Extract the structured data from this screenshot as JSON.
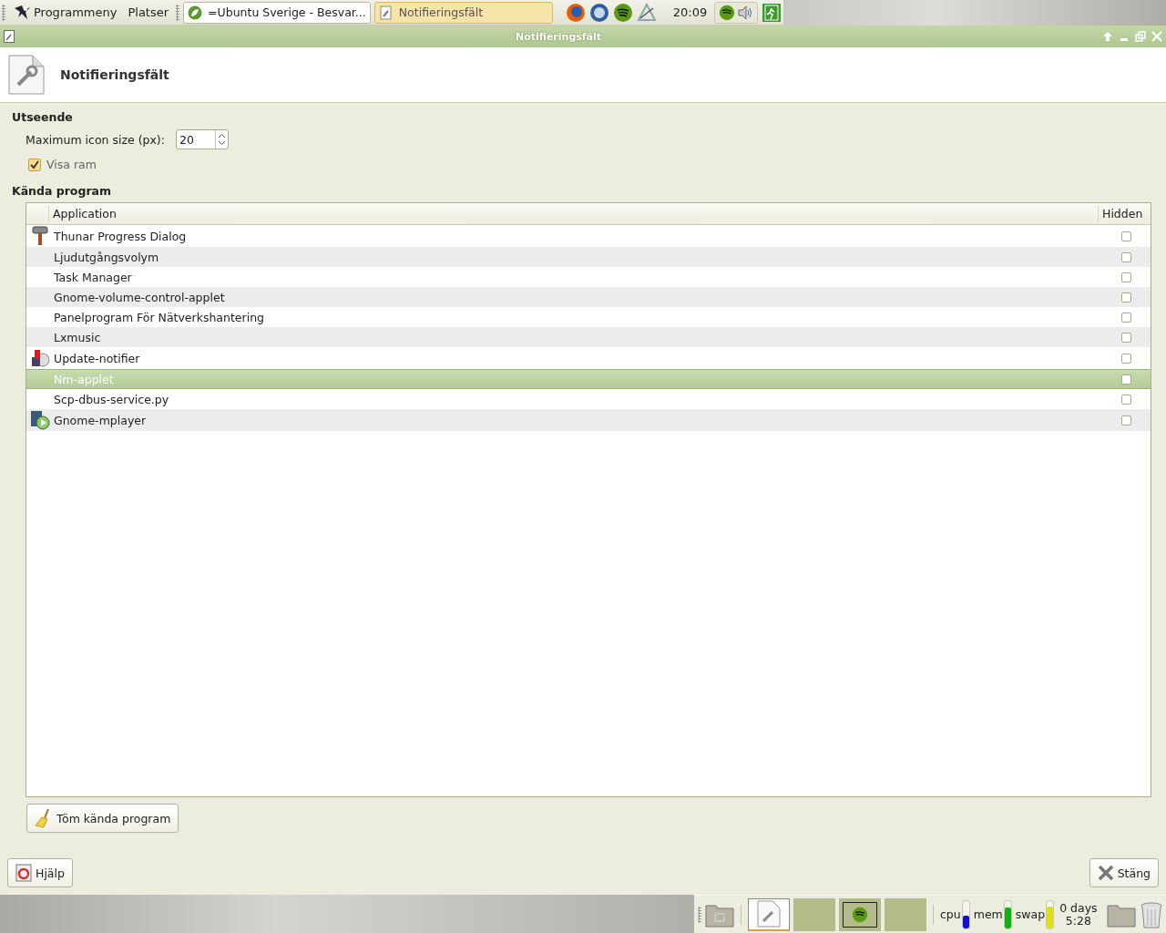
{
  "top_panel": {
    "menu": "Programmeny",
    "places": "Platser",
    "tasks": [
      {
        "title": "=Ubuntu Sverige - Besvar...",
        "kind": "leaf",
        "selected": false
      },
      {
        "title": "Notifieringsfält",
        "kind": "tool",
        "selected": true
      }
    ],
    "clock": "20:09"
  },
  "window": {
    "title": "Notifieringsfält"
  },
  "header": {
    "title": "Notifieringsfält"
  },
  "appearance": {
    "heading": "Utseende",
    "icon_size_label": "Maximum icon size (px):",
    "icon_size_value": "20",
    "show_frame": {
      "label": "Visa ram",
      "checked": true
    }
  },
  "known_programs": {
    "heading": "Kända program",
    "columns": [
      "Application",
      "Hidden"
    ],
    "rows": [
      {
        "name": "Thunar Progress Dialog",
        "kind": "thunar",
        "hidden": false,
        "selected": false
      },
      {
        "name": "Ljudutgångsvolym",
        "hidden": false,
        "selected": false
      },
      {
        "name": "Task Manager",
        "hidden": false,
        "selected": false
      },
      {
        "name": "Gnome-volume-control-applet",
        "hidden": false,
        "selected": false
      },
      {
        "name": "Panelprogram För Nätverkshantering",
        "hidden": false,
        "selected": false
      },
      {
        "name": "Lxmusic",
        "hidden": false,
        "selected": false
      },
      {
        "name": "Update-notifier",
        "kind": "update",
        "hidden": false,
        "selected": false
      },
      {
        "name": "Nm-applet",
        "hidden": false,
        "selected": true
      },
      {
        "name": "Scp-dbus-service.py",
        "hidden": false,
        "selected": false
      },
      {
        "name": "Gnome-mplayer",
        "kind": "mplayer",
        "hidden": false,
        "selected": false
      }
    ],
    "clear_button": "Töm kända program"
  },
  "buttons": {
    "help": "Hjälp",
    "close": "Stäng"
  },
  "bottom_panel": {
    "meters": [
      {
        "label": "cpu",
        "level": 0.45,
        "color": "#1010d0"
      },
      {
        "label": "mem",
        "level": 0.75,
        "color": "#10b010"
      },
      {
        "label": "swap",
        "level": 0.8,
        "color": "#e0e010"
      }
    ],
    "uptime_days": "0 days",
    "uptime_time": "5:28"
  }
}
